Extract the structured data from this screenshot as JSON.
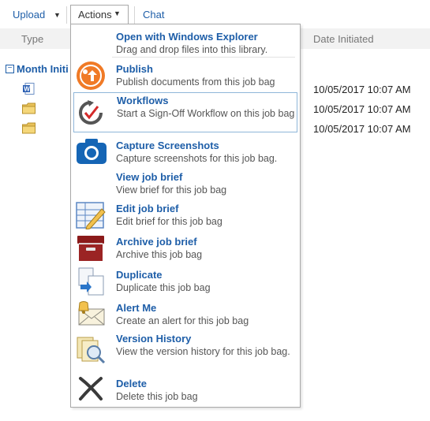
{
  "toolbar": {
    "upload_label": "Upload",
    "actions_label": "Actions",
    "chat_label": "Chat"
  },
  "list": {
    "columns": {
      "type": "Type",
      "date_initiated": "Date Initiated"
    },
    "group_label": "Month Initi",
    "rows": [
      {
        "icon": "word-document-icon",
        "date": "10/05/2017 10:07 AM"
      },
      {
        "icon": "folder-icon",
        "date": "10/05/2017 10:07 AM"
      },
      {
        "icon": "folder-icon",
        "date": "10/05/2017 10:07 AM"
      }
    ]
  },
  "menu": {
    "items": [
      {
        "title": "Open with Windows Explorer",
        "desc": "Drag and drop files into this library.",
        "icon": ""
      },
      {
        "title": "Publish",
        "desc": "Publish documents from this job bag",
        "icon": "publish-icon"
      },
      {
        "title": "Workflows",
        "desc": "Start a Sign-Off Workflow on this job bag",
        "icon": "workflow-icon"
      },
      {
        "title": "Capture Screenshots",
        "desc": "Capture screenshots for this job bag.",
        "icon": "camera-icon"
      },
      {
        "title": "View job brief",
        "desc": "View brief for this job bag",
        "icon": ""
      },
      {
        "title": "Edit job brief",
        "desc": "Edit brief for this job bag",
        "icon": "edit-form-icon"
      },
      {
        "title": "Archive job brief",
        "desc": "Archive this job bag",
        "icon": "archive-box-icon"
      },
      {
        "title": "Duplicate",
        "desc": "Duplicate this job bag",
        "icon": "duplicate-icon"
      },
      {
        "title": "Alert Me",
        "desc": "Create an alert for this job bag",
        "icon": "alert-bell-icon"
      },
      {
        "title": "Version History",
        "desc": "View the version history for this job bag.",
        "icon": "version-history-icon"
      },
      {
        "title": "Delete",
        "desc": "Delete this job bag",
        "icon": "delete-x-icon"
      }
    ]
  },
  "colors": {
    "link_blue": "#1e5ea8",
    "publish_orange": "#f07a26",
    "camera_blue": "#1565b5",
    "archive_red": "#8b1a1a"
  }
}
